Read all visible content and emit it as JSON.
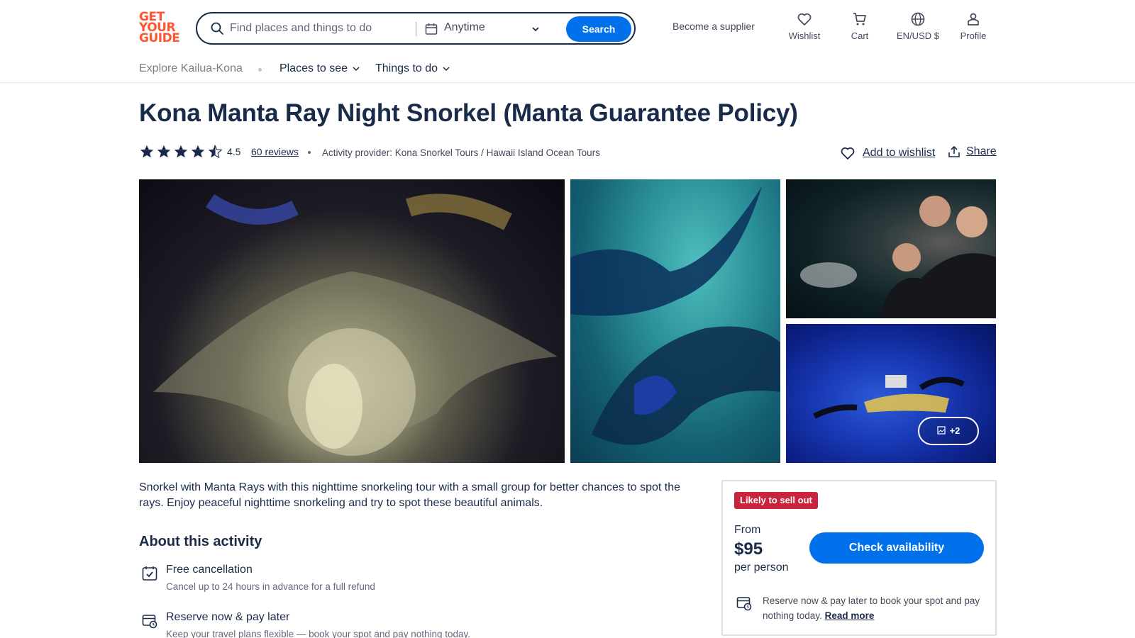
{
  "header": {
    "logo_lines": [
      "GET",
      "YOUR",
      "GUIDE"
    ],
    "search": {
      "placeholder": "Find places and things to do",
      "date_value": "Anytime",
      "button_label": "Search"
    },
    "become_supplier": "Become a supplier",
    "nav": [
      {
        "label": "Wishlist",
        "icon": "heart-icon"
      },
      {
        "label": "Cart",
        "icon": "cart-icon"
      },
      {
        "label": "EN/USD $",
        "icon": "globe-icon"
      },
      {
        "label": "Profile",
        "icon": "profile-icon"
      }
    ]
  },
  "subnav": {
    "explore": "Explore Kailua-Kona",
    "items": [
      {
        "label": "Places to see"
      },
      {
        "label": "Things to do"
      }
    ]
  },
  "activity": {
    "title": "Kona Manta Ray Night Snorkel (Manta Guarantee Policy)",
    "rating": "4.5",
    "rating_value": 4.5,
    "reviews_label": "60 reviews",
    "provider": "Activity provider: Kona Snorkel Tours / Hawaii Island Ocean Tours",
    "wishlist_label": "Add to wishlist",
    "share_label": "Share"
  },
  "gallery": {
    "more_label": "+2"
  },
  "description": "Snorkel with Manta Rays with this nighttime snorkeling tour with a small group for better chances to spot the rays. Enjoy peaceful nighttime snorkeling and try to spot these beautiful animals.",
  "about": {
    "heading": "About this activity",
    "features": [
      {
        "title": "Free cancellation",
        "subtitle": "Cancel up to 24 hours in advance for a full refund",
        "icon": "calendar-check-icon"
      },
      {
        "title": "Reserve now & pay later",
        "subtitle": "Keep your travel plans flexible — book your spot and pay nothing today.",
        "icon": "calendar-pay-icon"
      }
    ]
  },
  "booking": {
    "badge": "Likely to sell out",
    "from_label": "From",
    "price": "$95",
    "per_label": "per person",
    "button_label": "Check availability",
    "reserve_text": "Reserve now & pay later to book your spot and pay nothing today.",
    "read_more": "Read more"
  },
  "colors": {
    "primary": "#0071eb",
    "brand": "#ff5533",
    "text": "#1a2b49",
    "badge": "#c9243b"
  }
}
